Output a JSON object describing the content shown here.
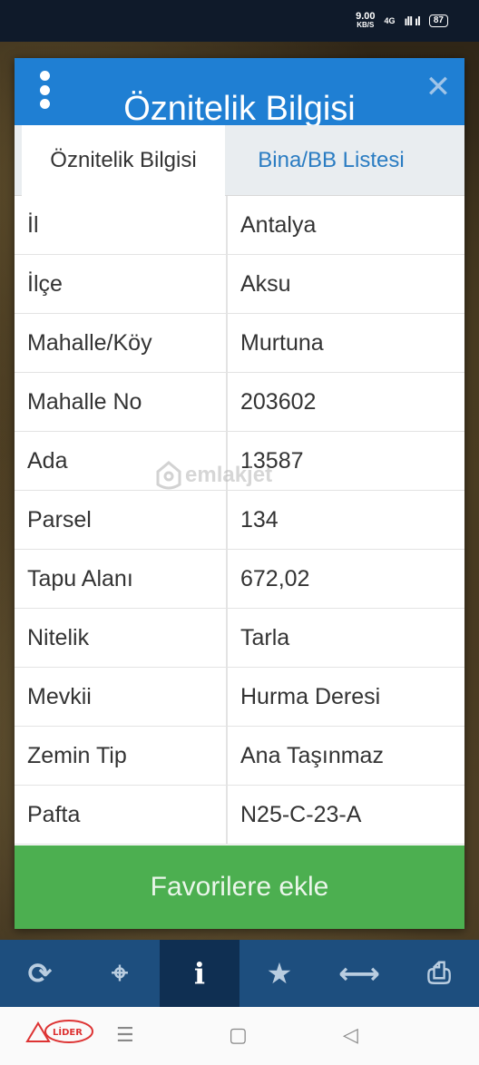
{
  "status": {
    "speed_value": "9.00",
    "speed_unit": "KB/S",
    "network": "4G",
    "signal": "ıll ıl",
    "battery": "87"
  },
  "dialog": {
    "title": "Öznitelik Bilgisi",
    "close_glyph": "✕",
    "tabs": [
      {
        "label": "Öznitelik Bilgisi"
      },
      {
        "label": "Bina/BB Listesi"
      }
    ],
    "rows": [
      {
        "key": "İl",
        "value": "Antalya"
      },
      {
        "key": "İlçe",
        "value": "Aksu"
      },
      {
        "key": "Mahalle/Köy",
        "value": "Murtuna"
      },
      {
        "key": "Mahalle No",
        "value": "203602"
      },
      {
        "key": "Ada",
        "value": "13587"
      },
      {
        "key": "Parsel",
        "value": "134"
      },
      {
        "key": "Tapu Alanı",
        "value": "672,02"
      },
      {
        "key": "Nitelik",
        "value": "Tarla"
      },
      {
        "key": "Mevkii",
        "value": "Hurma Deresi"
      },
      {
        "key": "Zemin Tip",
        "value": "Ana Taşınmaz"
      },
      {
        "key": "Pafta",
        "value": "N25-C-23-A"
      }
    ],
    "favorite_button": "Favorilere ekle"
  },
  "watermark": "emlakjet",
  "toolbar": {
    "icons": [
      "refresh-icon",
      "crosshair-icon",
      "info-icon",
      "star-icon",
      "measure-icon",
      "print-icon"
    ],
    "glyphs": [
      "⟳",
      "⌖",
      "i",
      "★",
      "⟷",
      "⎙"
    ]
  },
  "brand_logo": "LİDER",
  "navbar": {
    "menu_glyph": "☰",
    "home_glyph": "▢",
    "back_glyph": "◁"
  },
  "colors": {
    "header_blue": "#1f7fd3",
    "favorite_green": "#4caf50",
    "toolbar_blue": "#1d4e7e"
  }
}
